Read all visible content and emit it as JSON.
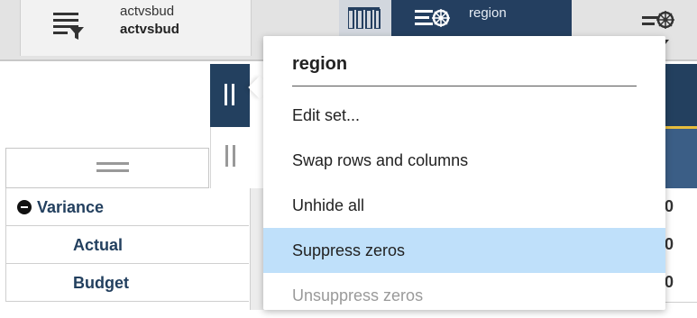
{
  "toolbar": {
    "dimension_tile": {
      "title": "actvsbud",
      "subtitle": "actvsbud",
      "icon": "filter-list-icon"
    },
    "mid_tile": {
      "icon": "columns-icon"
    },
    "region_tile": {
      "label": "region",
      "icon": "list-gear-icon",
      "bg_color": "#243f60"
    },
    "right_tile": {
      "icon": "list-gear-icon"
    }
  },
  "grid": {
    "handle_dark_color": "#23405f",
    "rows": [
      {
        "label": "Variance",
        "expandable": true
      },
      {
        "label": "Actual"
      },
      {
        "label": "Budget"
      }
    ],
    "right_values": [
      "0",
      "0",
      "0"
    ]
  },
  "context_menu": {
    "title": "region",
    "items": [
      {
        "label": "Edit set...",
        "state": "normal"
      },
      {
        "label": "Swap rows and columns",
        "state": "normal"
      },
      {
        "label": "Unhide all",
        "state": "normal"
      },
      {
        "label": "Suppress zeros",
        "state": "highlighted"
      },
      {
        "label": "Unsuppress zeros",
        "state": "disabled"
      }
    ],
    "highlight_color": "#bfe0fa"
  }
}
